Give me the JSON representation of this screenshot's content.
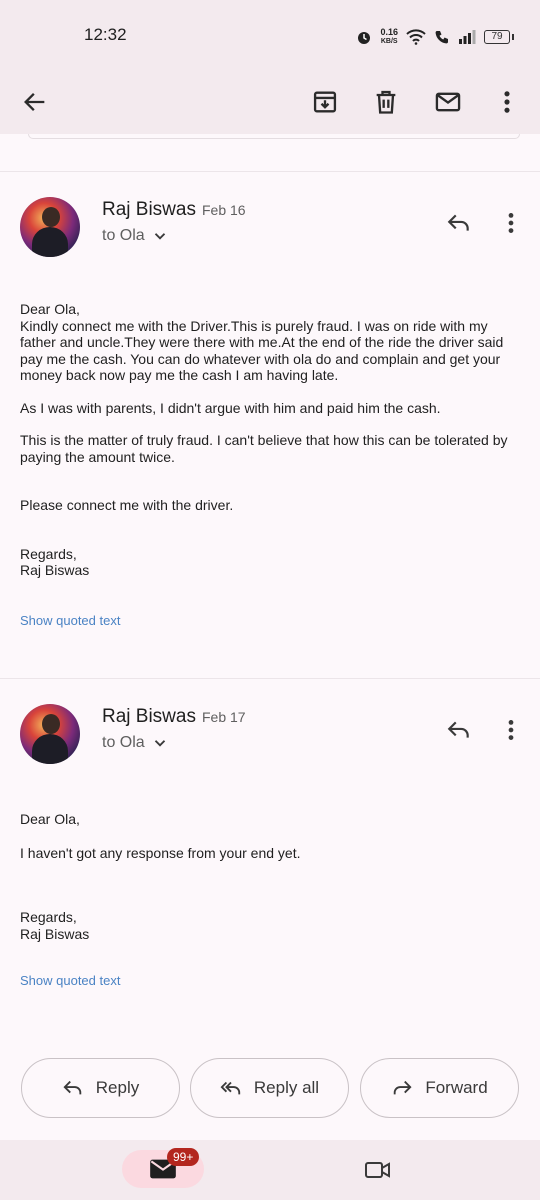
{
  "status": {
    "time": "12:32",
    "speed_value": "0.16",
    "speed_unit": "KB/S",
    "battery": "79"
  },
  "messages": [
    {
      "sender": "Raj Biswas",
      "date": "Feb 16",
      "to": "to Ola",
      "paragraphs": [
        "Dear Ola,\nKindly connect me with the Driver.This is purely fraud. I was on ride with my father and uncle.They were there with me.At the end of the ride the driver said pay me the cash. You can do whatever with ola do and complain and get your money back now pay me the cash I am having late.",
        "As I was with parents, I didn't argue with him and paid him the cash.",
        "This is the matter of truly fraud. I can't believe that how this can be tolerated by paying the amount twice.",
        "Please connect me with the driver.",
        "Regards,\nRaj Biswas"
      ],
      "show_quoted": "Show quoted text"
    },
    {
      "sender": "Raj Biswas",
      "date": "Feb 17",
      "to": "to Ola",
      "paragraphs": [
        "Dear Ola,",
        "I haven't got any response from your end yet.",
        "Regards,\nRaj Biswas"
      ],
      "show_quoted": "Show quoted text"
    }
  ],
  "actions": {
    "reply": "Reply",
    "reply_all": "Reply all",
    "forward": "Forward"
  },
  "nav": {
    "mail_badge": "99+"
  }
}
